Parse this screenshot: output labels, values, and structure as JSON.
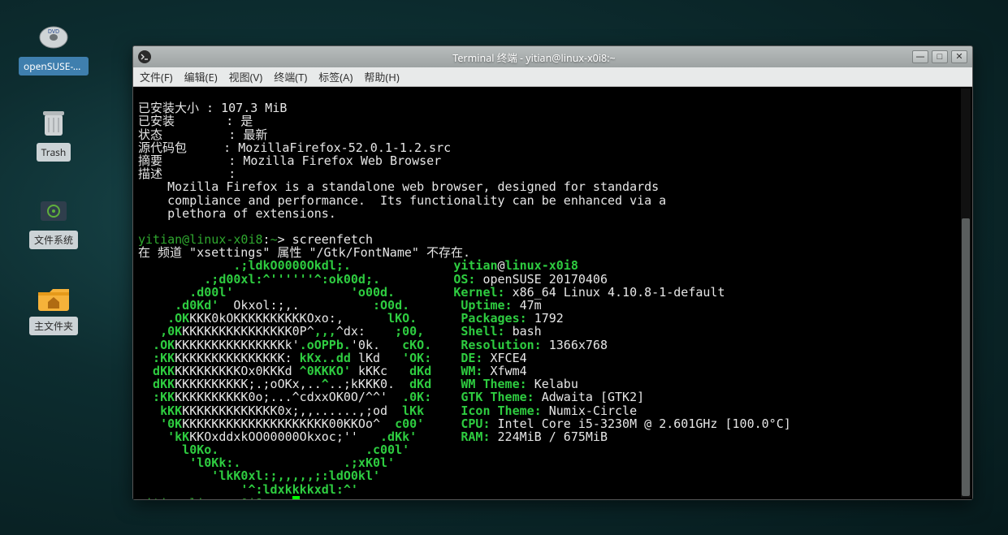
{
  "desktop": {
    "icons": [
      {
        "id": "opensuse-disc",
        "label": "openSUSE-T···",
        "kind": "disc-icon"
      },
      {
        "id": "trash",
        "label": "Trash",
        "kind": "trash-icon"
      },
      {
        "id": "filesystem",
        "label": "文件系统",
        "kind": "filesystem-icon"
      },
      {
        "id": "home",
        "label": "主文件夹",
        "kind": "home-folder-icon"
      }
    ]
  },
  "window": {
    "title": "Terminal 终端 - yitian@linux-x0i8:~",
    "menus": [
      "文件(F)",
      "编辑(E)",
      "视图(V)",
      "终端(T)",
      "标签(A)",
      "帮助(H)"
    ],
    "controls": {
      "minimize": "—",
      "maximize": "□",
      "close": "✕"
    }
  },
  "pkg": {
    "size_label": "已安装大小",
    "size_value": "107.3 MiB",
    "installed_label": "已安装",
    "installed_value": "是",
    "status_label": "状态",
    "status_value": "最新",
    "srcpkg_label": "源代码包",
    "srcpkg_value": "MozillaFirefox-52.0.1-1.2.src",
    "summary_label": "摘要",
    "summary_value": "Mozilla Firefox Web Browser",
    "desc_label": "描述",
    "desc1": "Mozilla Firefox is a standalone web browser, designed for standards",
    "desc2": "compliance and performance.  Its functionality can be enhanced via a",
    "desc3": "plethora of extensions."
  },
  "prompt": {
    "user_host": "yitian@linux-x0i8",
    "cwd": "~",
    "cmd": "screenfetch",
    "warn": "在 频道 \"xsettings\" 属性 \"/Gtk/FontName\" 不存在."
  },
  "fetch": {
    "user": "yitian",
    "host": "linux-x0i8",
    "os_label": "OS:",
    "os_value": "openSUSE 20170406",
    "kernel_label": "Kernel:",
    "kernel_value": "x86_64 Linux 4.10.8-1-default",
    "uptime_label": "Uptime:",
    "uptime_value": "47m",
    "packages_label": "Packages:",
    "packages_value": "1792",
    "shell_label": "Shell:",
    "shell_value": "bash",
    "res_label": "Resolution:",
    "res_value": "1366x768",
    "de_label": "DE:",
    "de_value": "XFCE4",
    "wm_label": "WM:",
    "wm_value": "Xfwm4",
    "wmth_label": "WM Theme:",
    "wmth_value": "Kelabu",
    "gtk_label": "GTK Theme:",
    "gtk_value": "Adwaita [GTK2]",
    "icon_label": "Icon Theme:",
    "icon_value": "Numix-Circle",
    "cpu_label": "CPU:",
    "cpu_value": "Intel Core i5-3230M @ 2.601GHz [100.0°C]",
    "ram_label": "RAM:",
    "ram_value": "224MiB / 675MiB"
  },
  "ascii": {
    "l01a": "             .;ldkO0000Okdl;.",
    "l02a": "         .;d00xl:^''''''^:ok00d;.",
    "l03a": "       .d00l'                'o00d.",
    "l04a": "     .d0Kd'",
    "l04b": "  Okxol:;,.",
    "l04c": "          :O0d.",
    "l05a": "    .OK",
    "l05b": "KKK0kOKKKKKKKKKKOxo:,",
    "l05c": "      lKO.",
    "l06a": "   ,0K",
    "l06b": "KKKKKKKKKKKKKKK0P^",
    "l06c": ",,,",
    "l06d": "^dx:",
    "l06e": "    ;00,",
    "l07a": "  .OK",
    "l07b": "KKKKKKKKKKKKKKKk'",
    "l07c": ".oOPPb.",
    "l07d": "'0k.",
    "l07e": "   cKO.",
    "l08a": "  :KK",
    "l08b": "KKKKKKKKKKKKKKK:",
    "l08c": " kKx..dd ",
    "l08d": "lKd",
    "l08e": "   'OK:",
    "l09a": "  dKK",
    "l09b": "KKKKKKKKKOx0KKKd",
    "l09c": " ^0KKKO' ",
    "l09d": "kKKc",
    "l09e": "   dKd",
    "l10a": "  dKK",
    "l10b": "KKKKKKKKKK;.;oOKx,..",
    "l10c": "^",
    "l10d": "..;kKKK0.",
    "l10e": "  dKd",
    "l11a": "  :KK",
    "l11b": "KKKKKKKKKK0o;...^cdxxOK0O/^^'",
    "l11c": "  .0K:",
    "l12a": "   kKK",
    "l12b": "KKKKKKKKKKKKK0x;,,......,;od",
    "l12c": "  lKk",
    "l13a": "   '0K",
    "l13b": "KKKKKKKKKKKKKKKKKKKK00KKOo^",
    "l13c": "  c00'",
    "l14a": "    'kK",
    "l14b": "KKOxddxkOO00000Okxoc;''",
    "l14c": "   .dKk'",
    "l15a": "      l0Ko.                    .c00l'",
    "l16a": "       'l0Kk:.              .;xK0l'",
    "l17a": "          'lkK0xl:;,,,,,;:ldO0kl'",
    "l18a": "              '^:ldxkkkkxdl:^'"
  }
}
